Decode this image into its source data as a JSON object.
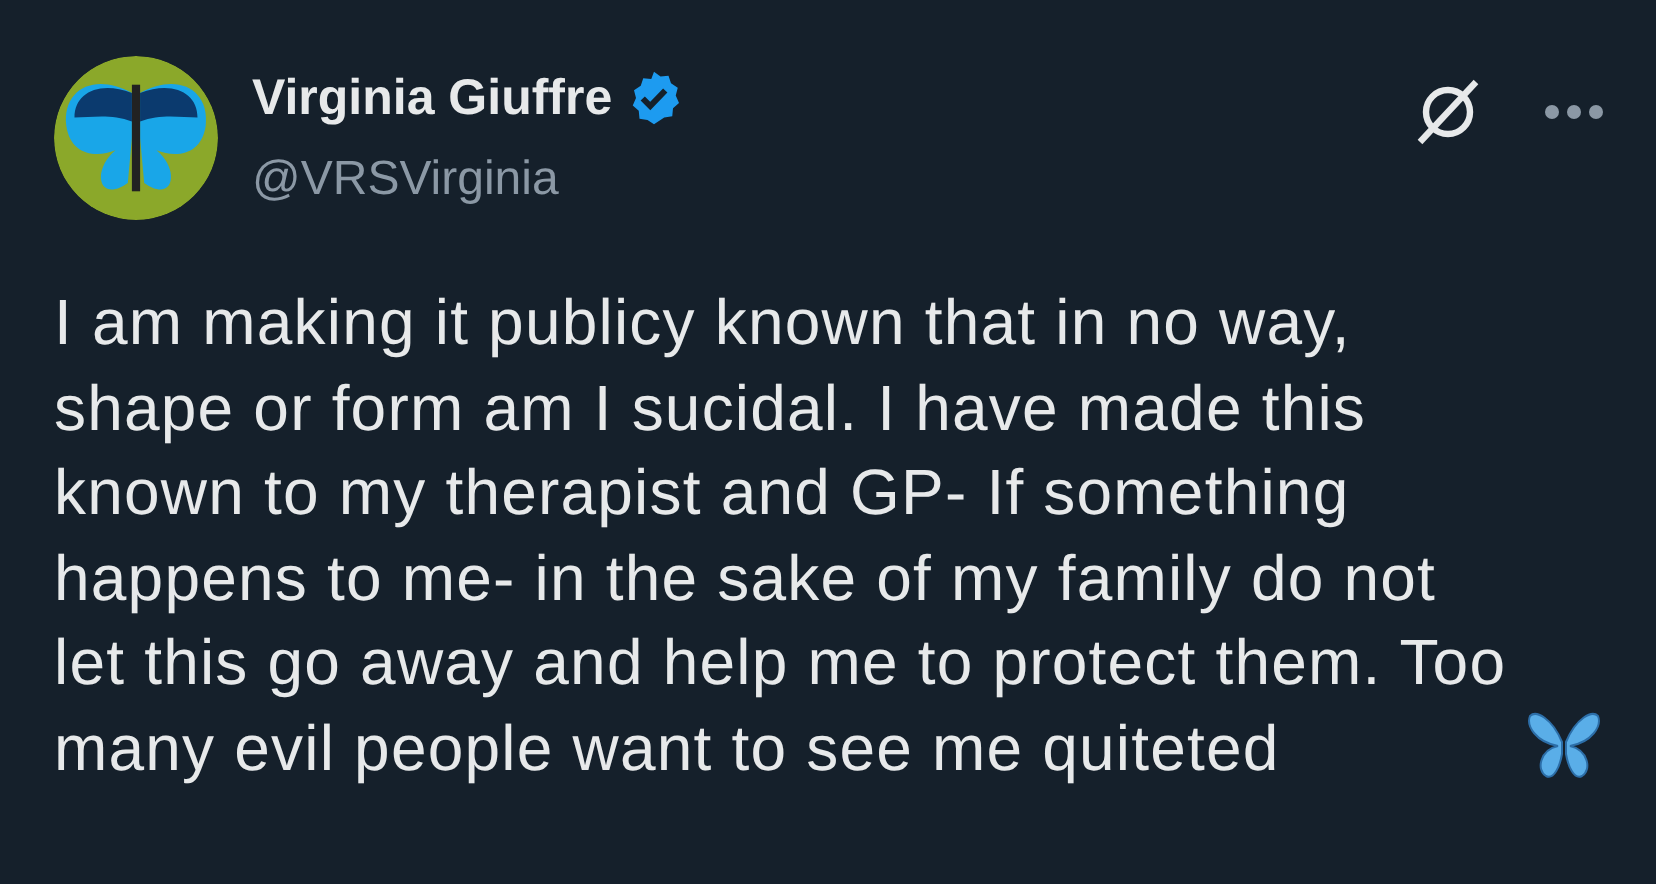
{
  "author": {
    "name": "Virginia Giuffre",
    "verified": true,
    "handle": "@VRSVirginia"
  },
  "tweet": {
    "text": "I am making it publicy known that in no way, shape or form am I sucidal. I have made this known to my therapist and GP- If something happens to me- in the sake of my family do not let this go away and help me to protect them. Too many evil people want to see me quiteted"
  }
}
